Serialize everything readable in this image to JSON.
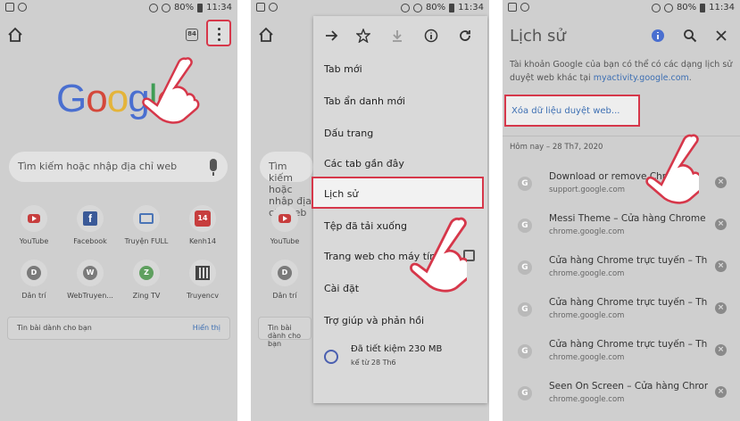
{
  "colors": {
    "highlight": "#d6374a",
    "link": "#3d6fb3",
    "dim_bg": "#cfcfcf"
  },
  "statusbar": {
    "battery": "80%",
    "time": "11:34"
  },
  "panel1": {
    "tab_count": "84",
    "logo_letters": [
      "G",
      "o",
      "o",
      "g",
      "l",
      "e"
    ],
    "search_placeholder": "Tìm kiếm hoặc nhập địa chỉ web",
    "tiles": [
      {
        "label": "YouTube",
        "icon": "youtube-icon"
      },
      {
        "label": "Facebook",
        "icon": "facebook-icon"
      },
      {
        "label": "Truyện FULL",
        "icon": "book-icon"
      },
      {
        "label": "Kenh14",
        "icon": "kenh14-icon",
        "glyph": "14"
      },
      {
        "label": "Dân trí",
        "icon": "letter-d-icon",
        "glyph": "D"
      },
      {
        "label": "WebTruyen...",
        "icon": "letter-w-icon",
        "glyph": "W"
      },
      {
        "label": "Zing TV",
        "icon": "letter-z-icon",
        "glyph": "Z"
      },
      {
        "label": "Truyencv",
        "icon": "qr-icon"
      }
    ],
    "news_title": "Tin bài dành cho bạn",
    "news_action": "Hiển thị"
  },
  "panel2": {
    "menu_items": [
      {
        "label": "Tab mới"
      },
      {
        "label": "Tab ẩn danh mới"
      },
      {
        "label": "Dấu trang"
      },
      {
        "label": "Các tab gần đây"
      },
      {
        "label": "Lịch sử"
      },
      {
        "label": "Tệp đã tải xuống"
      },
      {
        "label": "Trang web cho máy tính"
      },
      {
        "label": "Cài đặt"
      },
      {
        "label": "Trợ giúp và phản hồi"
      }
    ],
    "saved_line1": "Đã tiết kiệm 230 MB",
    "saved_line2": "kể từ 28 Th6"
  },
  "panel3": {
    "title": "Lịch sử",
    "desc_prefix": "Tài khoản Google của bạn có thể có các dạng lịch sử duyệt web khác tại ",
    "desc_link": "myactivity.google.com",
    "desc_suffix": ".",
    "clear_button": "Xóa dữ liệu duyệt web...",
    "day_header": "Hôm nay – 28 Th7, 2020",
    "rows": [
      {
        "title": "Download or remove Chrome",
        "url": "support.google.com"
      },
      {
        "title": "Messi Theme – Cửa hàng Chrome trực tuyến",
        "url": "chrome.google.com"
      },
      {
        "title": "Cửa hàng Chrome trực tuyến – Theme",
        "url": "chrome.google.com"
      },
      {
        "title": "Cửa hàng Chrome trực tuyến – Theme",
        "url": "chrome.google.com"
      },
      {
        "title": "Cửa hàng Chrome trực tuyến – Theme",
        "url": "chrome.google.com"
      },
      {
        "title": "Seen On Screen – Cửa hàng Chrome trực tuyến",
        "url": "chrome.google.com"
      }
    ]
  }
}
